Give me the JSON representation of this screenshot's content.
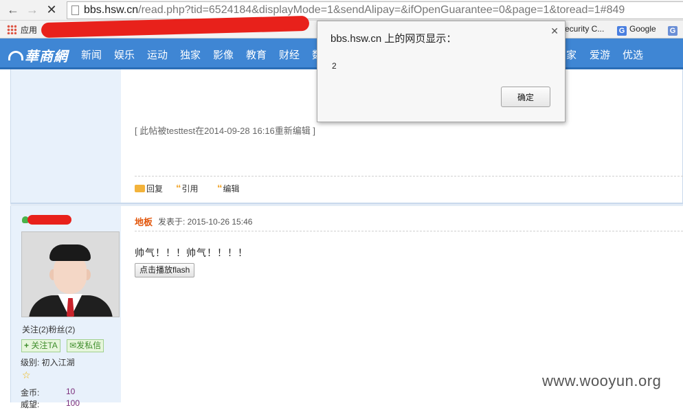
{
  "browser": {
    "url_host": "bbs.hsw.cn",
    "url_path": "/read.php?tid=6524184&displayMode=1&sendAlipay=&ifOpenGuarantee=0&page=1&toread=1#849",
    "bookmarks": {
      "apps_label": "应用",
      "security_label": "ecurity C...",
      "google_label": "Google"
    }
  },
  "site": {
    "logo_text": "華商網",
    "nav_items": [
      "新闻",
      "娱乐",
      "运动",
      "独家",
      "影像",
      "教育",
      "财经",
      "数",
      "家",
      "爱游",
      "优选"
    ]
  },
  "post1": {
    "edit_note": "[ 此帖被testtest在2014-09-28 16:16重新编辑 ]",
    "actions": {
      "reply": "回复",
      "quote": "引用",
      "edit": "编辑"
    }
  },
  "post2": {
    "user": {
      "follow_stats": "关注(2)粉丝(2)",
      "follow_button": "关注TA",
      "message_button": "发私信",
      "rank": "级别: 初入江湖",
      "gold_label": "金币:",
      "gold_value": "10",
      "score_label": "威望:",
      "score_value": "100"
    },
    "floor": "地板",
    "posted_at": "发表于: 2015-10-26 15:46",
    "content": "帅气！！！帅气！！！！",
    "flash_button": "点击播放flash"
  },
  "dialog": {
    "title": "bbs.hsw.cn 上的网页显示：",
    "message": "2",
    "ok_label": "确定"
  },
  "watermark": "www.wooyun.org",
  "colors": {
    "nav_blue": "#3f86d4",
    "floor_orange": "#e2560b",
    "redaction_red": "#e8211b",
    "value_purple": "#7a2d7a"
  }
}
